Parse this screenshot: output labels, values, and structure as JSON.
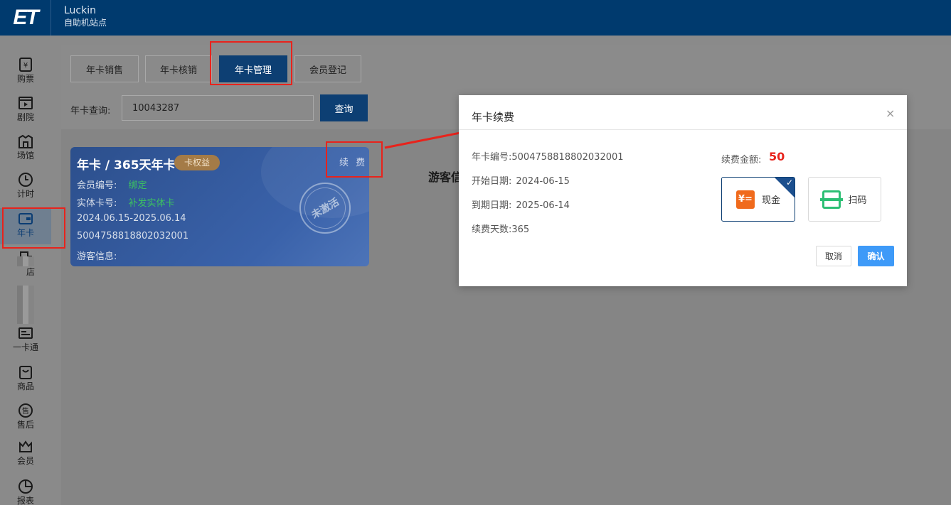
{
  "header": {
    "logo": "ET",
    "org_name": "Luckin",
    "station_name": "自助机站点"
  },
  "sidebar": {
    "items": [
      {
        "label": "购票",
        "icon": "ticket-icon"
      },
      {
        "label": "剧院",
        "icon": "theater-icon"
      },
      {
        "label": "场馆",
        "icon": "venue-icon"
      },
      {
        "label": "计时",
        "icon": "clock-icon"
      },
      {
        "label": "年卡",
        "icon": "card-icon",
        "active": true
      },
      {
        "label": "店",
        "icon": "shop-icon"
      },
      {
        "label": "一卡通",
        "icon": "id-card-icon"
      },
      {
        "label": "商品",
        "icon": "bag-icon"
      },
      {
        "label": "售后",
        "icon": "after-sale-icon"
      },
      {
        "label": "会员",
        "icon": "crown-icon"
      },
      {
        "label": "报表",
        "icon": "pie-chart-icon"
      }
    ]
  },
  "tabs": [
    {
      "label": "年卡销售"
    },
    {
      "label": "年卡核销"
    },
    {
      "label": "年卡管理",
      "active": true
    },
    {
      "label": "会员登记"
    }
  ],
  "search": {
    "label": "年卡查询:",
    "value": "10043287",
    "button": "查询"
  },
  "card": {
    "title": "年卡 / 365天年卡",
    "badge": "卡权益",
    "renew": "续 费",
    "member_label": "会员编号:",
    "member_value": "绑定",
    "physical_label": "实体卡号:",
    "physical_value": "补发实体卡",
    "validity": "2024.06.15-2025.06.14",
    "number": "5004758818802032001",
    "visitor_label": "游客信息:",
    "stamp": "未激活"
  },
  "visitor_heading": "游客信",
  "modal": {
    "title": "年卡续费",
    "close": "×",
    "card_no_label": "年卡编号:",
    "card_no": "5004758818802032001",
    "start_label": "开始日期:",
    "start": "2024-06-15",
    "end_label": "到期日期:",
    "end": "2025-06-14",
    "days_label": "续费天数:",
    "days": "365",
    "amount_label": "续费金额:",
    "amount": "50",
    "pay_methods": [
      {
        "label": "现金",
        "icon": "cash-icon",
        "selected": true
      },
      {
        "label": "扫码",
        "icon": "scan-icon",
        "selected": false
      }
    ],
    "cancel": "取消",
    "confirm": "确认"
  },
  "colors": {
    "header_bg": "#003a6e",
    "primary": "#0d3f73",
    "confirm": "#3e9af8",
    "highlight": "#e8231c",
    "cash": "#f06a1c",
    "scan": "#2dbf74"
  }
}
